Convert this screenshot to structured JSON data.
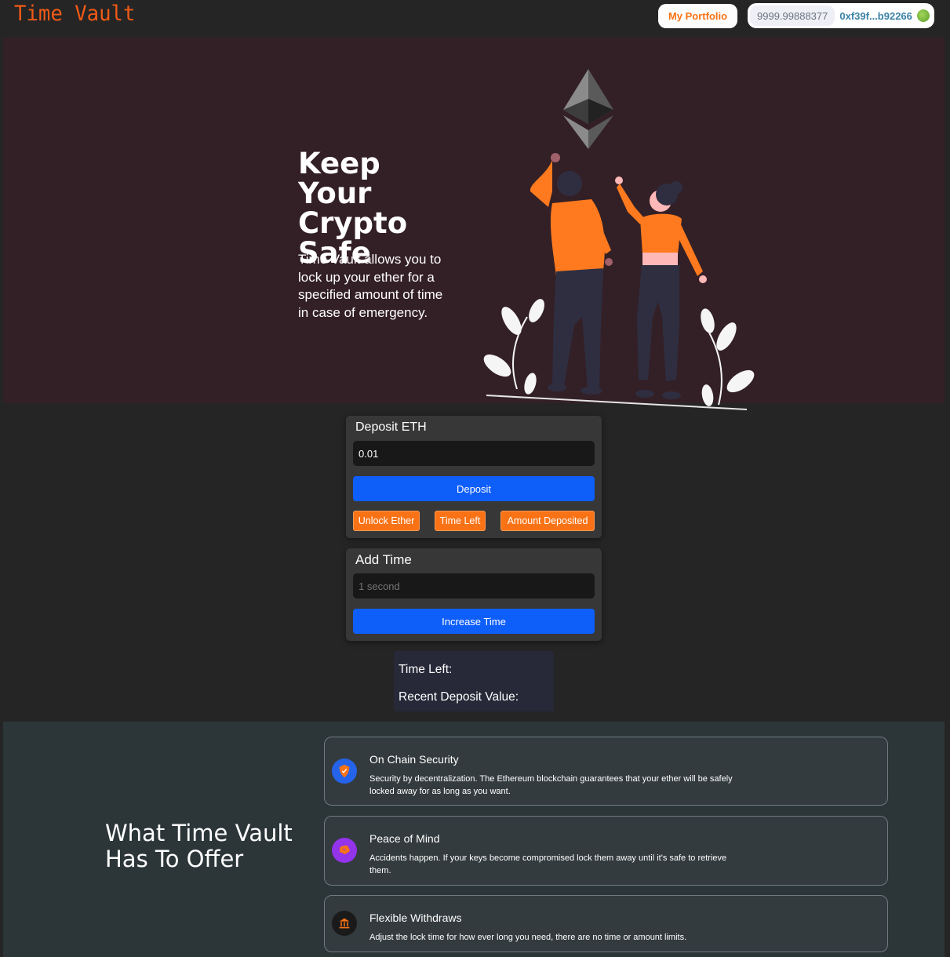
{
  "header": {
    "logo": "Time Vault",
    "portfolio_label": "My Portfolio",
    "wallet_balance": "9999.99888377",
    "wallet_address": "0xf39f...b92266"
  },
  "hero": {
    "title": "Keep Your Crypto Safe",
    "description": "Time Vault allows you to lock up your ether for a specified amount of time in case of emergency."
  },
  "deposit": {
    "title": "Deposit ETH",
    "amount_value": "0.01",
    "deposit_label": "Deposit",
    "unlock_label": "Unlock Ether",
    "time_left_label": "Time Left",
    "amount_deposited_label": "Amount Deposited"
  },
  "add_time": {
    "title": "Add Time",
    "time_placeholder": "1 second",
    "increase_label": "Increase Time"
  },
  "info": {
    "time_left": "Time Left:",
    "recent_deposit": "Recent Deposit Value:"
  },
  "features": {
    "title": "What Time Vault Has To Offer",
    "items": [
      {
        "title": "On Chain Security",
        "description": "Security by decentralization. The Ethereum blockchain guarantees that your ether will be safely locked away for as long as you want.",
        "icon": "shield-icon",
        "icon_color": "#2563eb"
      },
      {
        "title": "Peace of Mind",
        "description": "Accidents happen. If your keys become compromised lock them away until it's safe to retrieve them.",
        "icon": "brain-icon",
        "icon_color": "#9333ea"
      },
      {
        "title": "Flexible Withdraws",
        "description": "Adjust the lock time for how ever long you need, there are no time or amount limits.",
        "icon": "bank-icon",
        "icon_color": "#1a1a1a"
      }
    ]
  },
  "colors": {
    "accent_orange": "#f97316",
    "primary_blue": "#0e5efa",
    "hero_bg": "#332026"
  }
}
